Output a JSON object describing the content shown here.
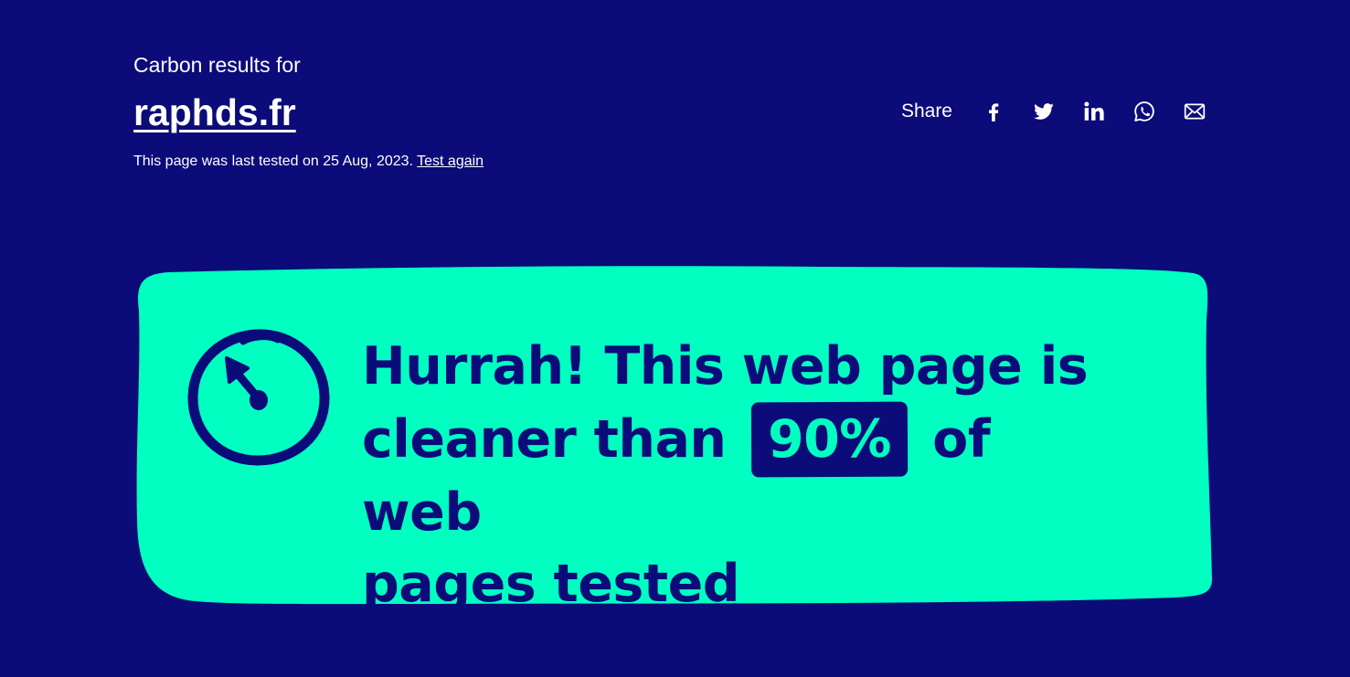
{
  "header": {
    "kicker": "Carbon results for",
    "site": "raphds.fr",
    "tested_prefix": "This page was last tested on 25 Aug, 2023.",
    "test_again_label": "Test again"
  },
  "share": {
    "label": "Share",
    "icons": [
      "facebook-icon",
      "twitter-icon",
      "linkedin-icon",
      "whatsapp-icon",
      "email-icon"
    ]
  },
  "result": {
    "line1": "Hurrah! This web page is",
    "line2_before": "cleaner than",
    "percent": "90%",
    "line2_after": "of web",
    "line3": "pages tested",
    "icon": "gauge-icon"
  },
  "colors": {
    "background": "#0b0b7a",
    "accent": "#00ffc0",
    "text": "#ffffff"
  }
}
